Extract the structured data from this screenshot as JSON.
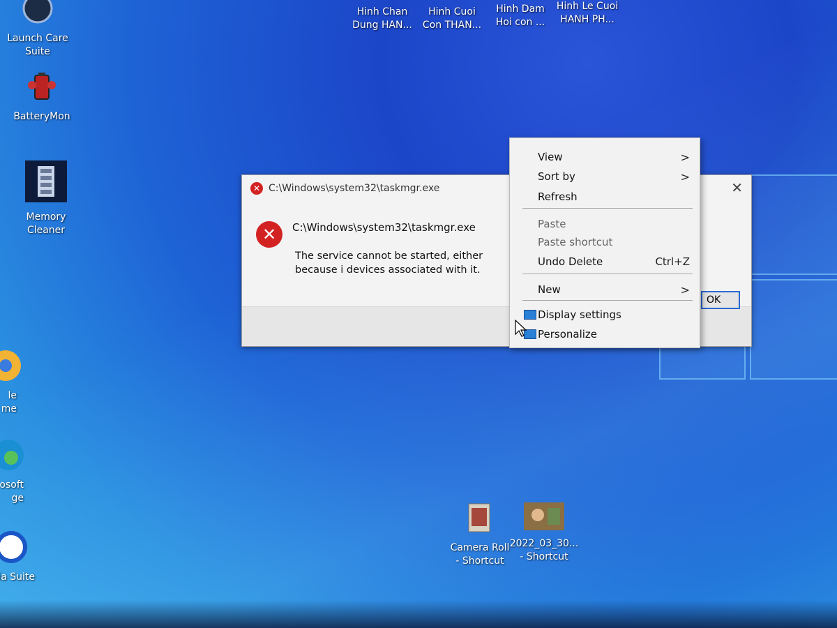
{
  "desktop": {
    "icons": [
      {
        "label": "Launch Care\nSuite",
        "icon": "launch-care-suite-icon"
      },
      {
        "label": "BatteryMon",
        "icon": "battery-mon-icon"
      },
      {
        "label": "Memory\nCleaner",
        "icon": "memory-cleaner-icon"
      },
      {
        "label": "le\nme",
        "icon": "chrome-icon"
      },
      {
        "label": "osoft\nge",
        "icon": "edge-icon"
      },
      {
        "label": "ia Suite",
        "icon": "media-suite-icon"
      },
      {
        "label": "Hinh Chan\nDung HAN...",
        "icon": "image-file-icon"
      },
      {
        "label": "Hinh Cuoi\nCon THAN...",
        "icon": "image-file-icon"
      },
      {
        "label": "Hinh Dam\nHoi con ...",
        "icon": "image-file-icon"
      },
      {
        "label": "Hinh Le Cuoi\nHANH PH...",
        "icon": "image-file-icon"
      },
      {
        "label": "Camera Roll\n- Shortcut",
        "icon": "folder-shortcut-icon"
      },
      {
        "label": "2022_03_30...\n- Shortcut",
        "icon": "photo-shortcut-icon"
      }
    ]
  },
  "dialog": {
    "title": "C:\\Windows\\system32\\taskmgr.exe",
    "path": "C:\\Windows\\system32\\taskmgr.exe",
    "message": "The service cannot be started, either because i devices associated with it.",
    "ok_label": "OK",
    "close_label": "✕"
  },
  "context_menu": {
    "view": "View",
    "sort_by": "Sort by",
    "refresh": "Refresh",
    "paste": "Paste",
    "paste_shortcut": "Paste shortcut",
    "undo_delete": "Undo Delete",
    "undo_shortcut": "Ctrl+Z",
    "new": "New",
    "display_settings": "Display settings",
    "personalize": "Personalize"
  },
  "colors": {
    "error_red": "#d32222",
    "focus_blue": "#2a6ad0",
    "desktop_blue": "#1e63d6"
  }
}
